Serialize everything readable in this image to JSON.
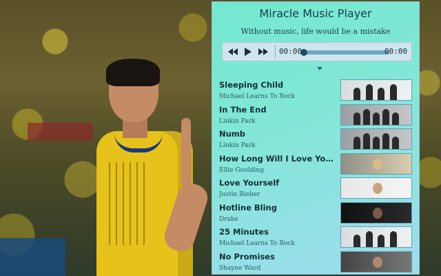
{
  "player": {
    "title": "Miracle Music Player",
    "subtitle": "Without music, life would be a mistake",
    "controls": {
      "current_time": "00:00",
      "duration": "00:00",
      "progress_fraction": 0.0
    }
  },
  "playlist": [
    {
      "song": "Sleeping Child",
      "artist": "Michael Learns To Rock",
      "thumb": "group-light"
    },
    {
      "song": "In The End",
      "artist": "Linkin Park",
      "thumb": "group-gray"
    },
    {
      "song": "Numb",
      "artist": "Linkin Park",
      "thumb": "group-gray"
    },
    {
      "song": "How Long Will I Love You...",
      "artist": "Ellie Goulding",
      "thumb": "portrait-blonde"
    },
    {
      "song": "Love Yourself",
      "artist": "Justin Bieber",
      "thumb": "portrait-light"
    },
    {
      "song": "Hotline Bling",
      "artist": "Drake",
      "thumb": "portrait-dark"
    },
    {
      "song": "25 Minutes",
      "artist": "Michael Learns To Rock",
      "thumb": "group-light"
    },
    {
      "song": "No Promises",
      "artist": "Shayne Ward",
      "thumb": "portrait-gray"
    }
  ],
  "colors": {
    "panel_top": "#73e8cf",
    "panel_bottom": "#9fdcf0",
    "text_dark": "#123038",
    "accent": "#2b6a85"
  }
}
